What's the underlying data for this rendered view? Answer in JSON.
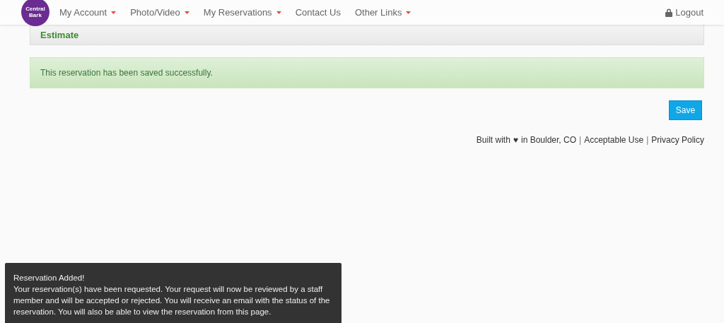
{
  "logo": {
    "line_1": "Central",
    "line_2": "Bark"
  },
  "nav": [
    {
      "label": "My Account",
      "dropdown": true
    },
    {
      "label": "Photo/Video",
      "dropdown": true
    },
    {
      "label": "My Reservations",
      "dropdown": true
    },
    {
      "label": "Contact Us",
      "dropdown": false
    },
    {
      "label": "Other Links",
      "dropdown": true
    }
  ],
  "logout": "Logout",
  "panel_title": "Estimate",
  "alert": "This reservation has been saved successfully.",
  "save_button": "Save",
  "footer": {
    "built": "Built with",
    "heart": "♥",
    "place": "in Boulder, CO",
    "separator_1": "|",
    "link_1": "Acceptable Use",
    "separator_2": "|",
    "link_2": "Privacy Policy"
  },
  "toast": {
    "title": "Reservation Added!",
    "message": "Your reservation(s) have been requested. Your request will now be reviewed by a staff member and will be accepted or rejected. You will receive an email with the status of the reservation. You will also be able to view the reservation from this page."
  }
}
